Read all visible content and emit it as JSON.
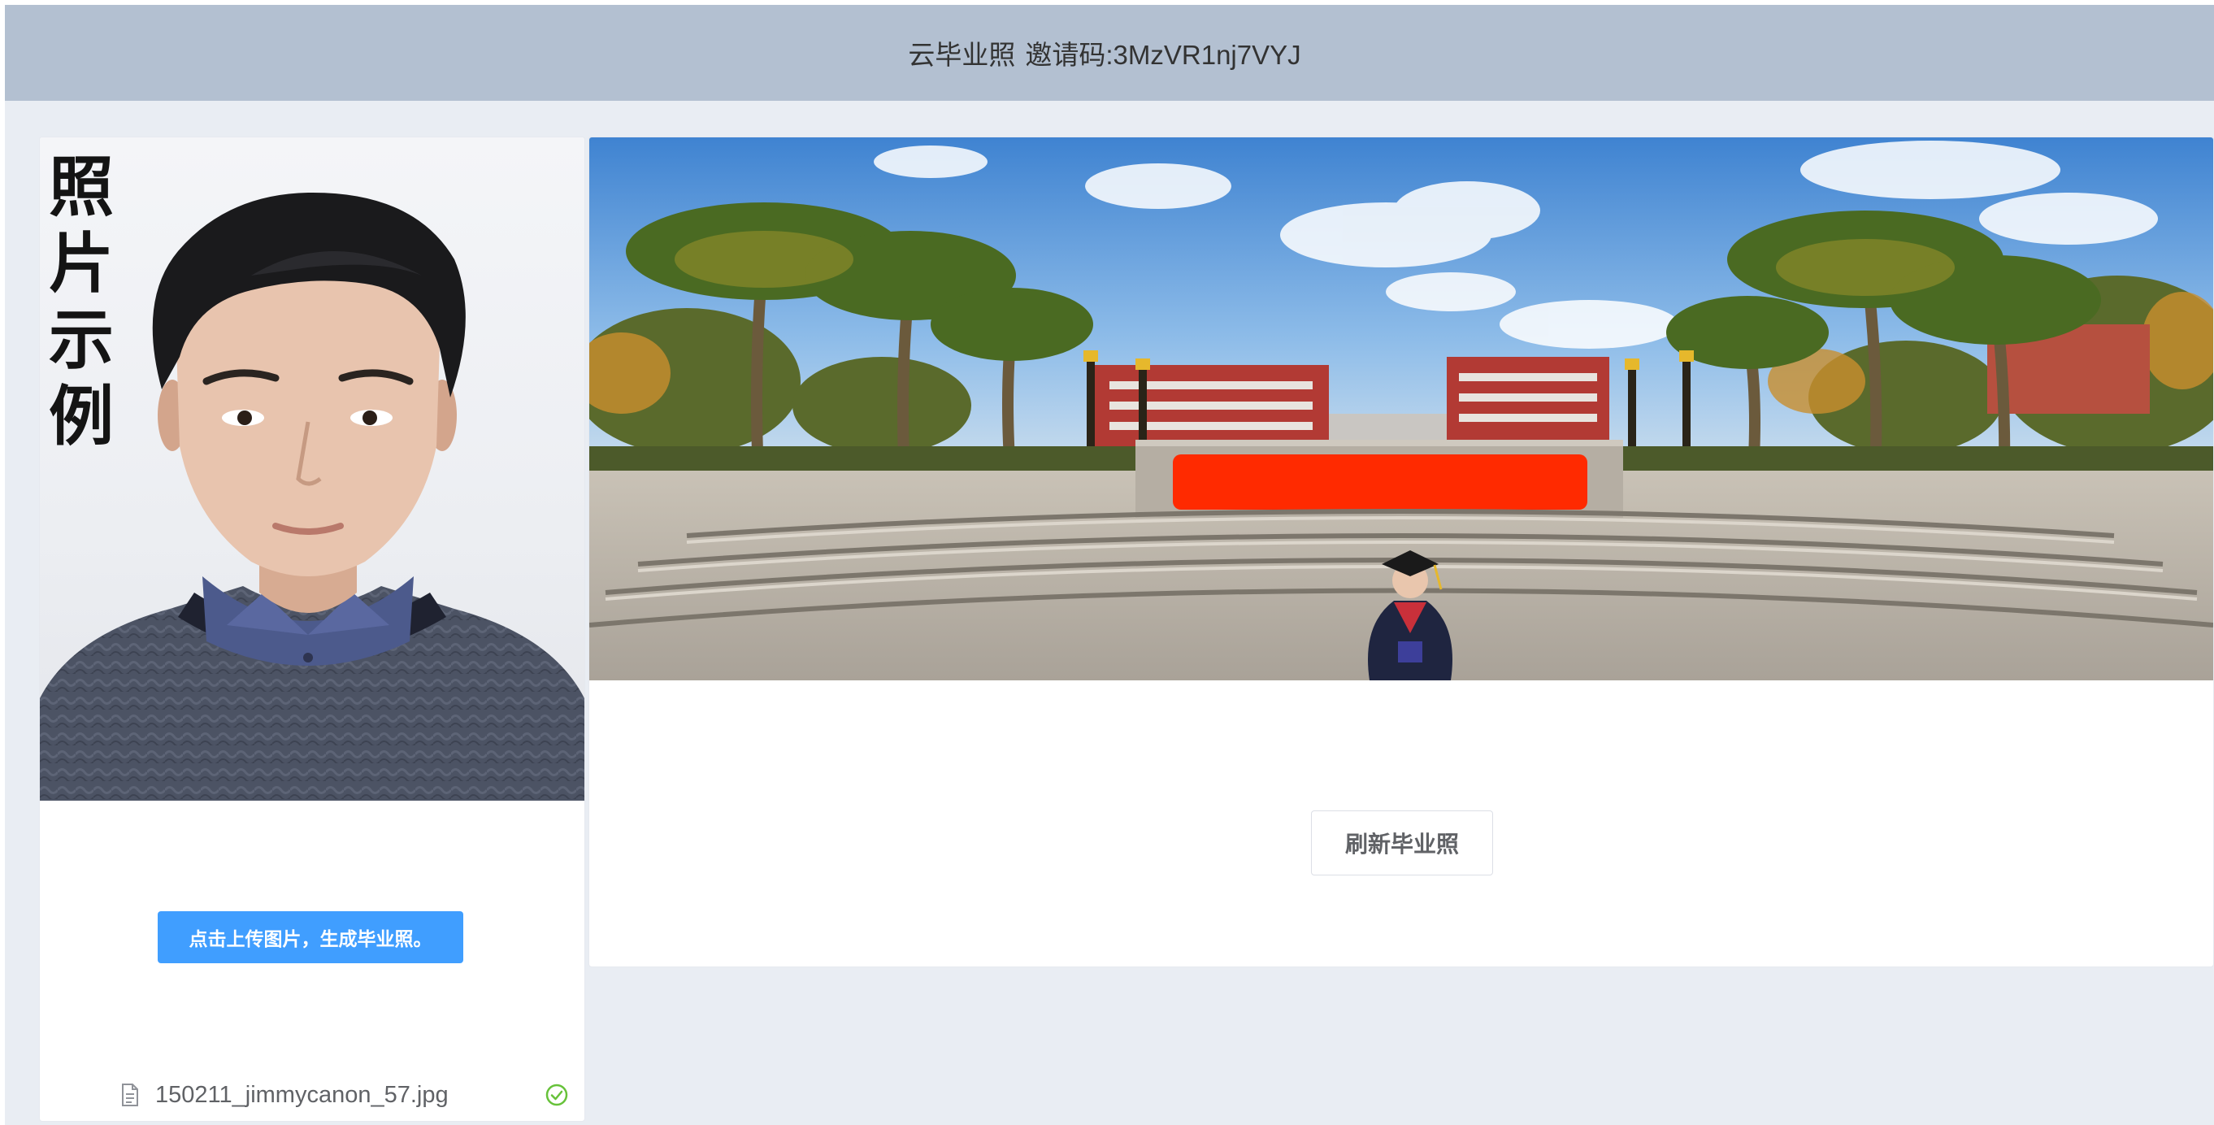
{
  "header": {
    "title": "云毕业照",
    "invite_code": "邀请码:3MzVR1nj7VYJ"
  },
  "left_panel": {
    "sample_label": "照片示例",
    "upload_button_label": "点击上传图片，生成毕业照。",
    "uploaded_file": {
      "name": "150211_jimmycanon_57.jpg",
      "status_icon": "check-circle-icon"
    }
  },
  "right_panel": {
    "refresh_button_label": "刷新毕业照"
  },
  "colors": {
    "header_bg": "#b3c0d1",
    "page_bg": "#e9edf3",
    "primary": "#409eff",
    "success": "#67c23a",
    "redaction": "#ff2a00"
  }
}
